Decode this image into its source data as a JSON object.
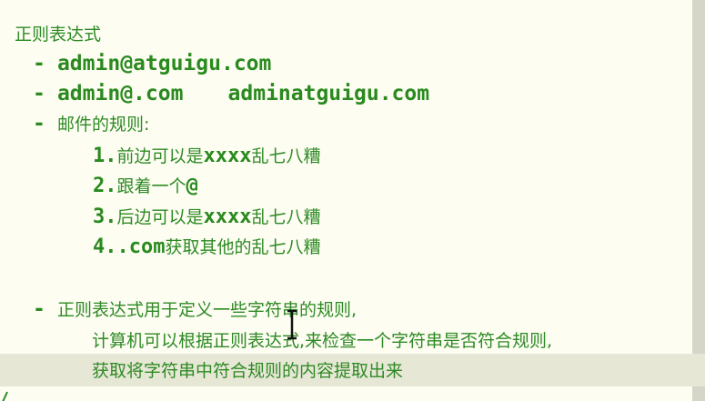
{
  "heading": "正则表达式",
  "bullets": {
    "dash": "-",
    "email_valid": "admin@atguigu.com",
    "email_invalid_1": "admin@.com",
    "email_invalid_2": "adminatguigu.com",
    "rules_title": "邮件的规则:",
    "rules": [
      {
        "num": "1.",
        "text": "前边可以是",
        "mono": "xxxx",
        "tail": "乱七八糟"
      },
      {
        "num": "2.",
        "text": "跟着一个",
        "mono": "@",
        "tail": ""
      },
      {
        "num": "3.",
        "text": "后边可以是",
        "mono": "xxxx",
        "tail": "乱七八糟"
      },
      {
        "num": "4.",
        "mono_pre": ".com",
        "text": "获取其他的乱七八糟"
      }
    ],
    "definition_1": "正则表达式用于定义一些字符串的规则,",
    "definition_2": "计算机可以根据正则表达式,来检查一个字符串是否符合规则,",
    "definition_3": "获取将字符串中符合规则的内容提取出来"
  },
  "colors": {
    "text": "#2e8a24",
    "background": "#fdfdf2",
    "current_line": "#e7e7d6"
  },
  "icons": [
    "text-cursor-icon"
  ]
}
